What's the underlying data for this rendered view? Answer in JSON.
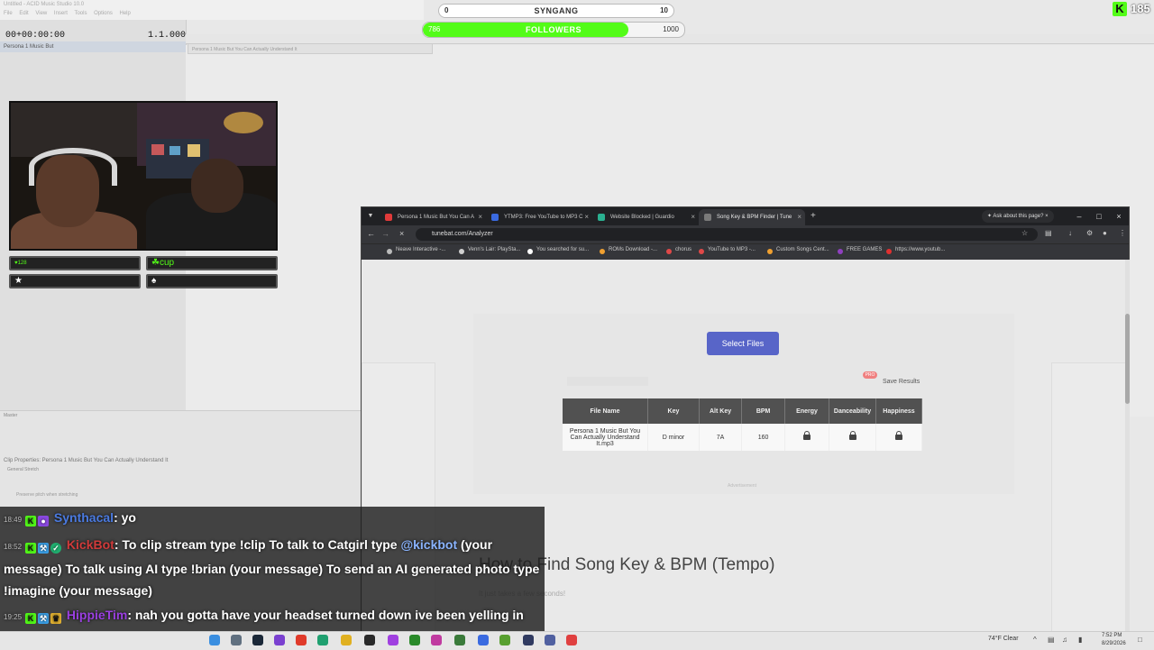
{
  "daw": {
    "title": "Untitled - ACID Music Studio 10.0",
    "menu": "File Edit View Insert Tools Options Help",
    "time": "00+00:00:00",
    "beat": "1.1.000",
    "track_name": "Persona 1 Music But",
    "clip_name": "Persona 1 Music But You Can Actually Understand It",
    "master": "Master",
    "clip_properties": "Clip Properties: Persona 1 Music But You Can Actually Understand It",
    "tabs": "General   Stretch",
    "preserve": "Preserve pitch when stretching"
  },
  "overlay": {
    "syngang": {
      "left": "0",
      "label": "SYNGANG",
      "right": "10",
      "progress": 0.0
    },
    "followers": {
      "left": "786",
      "label": "FOLLOWERS",
      "right": "1000",
      "progress": 0.786
    },
    "kick_count": "185",
    "kick_letter": "K"
  },
  "webcam_badges": [
    "♥128",
    "☘cup",
    "★",
    "♠"
  ],
  "browser": {
    "tabs": [
      {
        "label": "Persona 1 Music But You Can A",
        "color": "#e03a3a"
      },
      {
        "label": "YTMP3: Free YouTube to MP3 C",
        "color": "#3a6ae0"
      },
      {
        "label": "Website Blocked | Guardio",
        "color": "#2ab090"
      },
      {
        "label": "Song Key & BPM Finder | Tune",
        "color": "#7a7a7a"
      }
    ],
    "ask_page": "Ask about this page?",
    "url": "tunebat.com/Analyzer",
    "bookmarks": [
      {
        "label": "Neave Interactive -...",
        "color": "#bbbbbb"
      },
      {
        "label": "Venn's Lair: PlaySta...",
        "color": "#d0d0d0"
      },
      {
        "label": "You searched for su...",
        "color": "#ffffff"
      },
      {
        "label": "ROMs Download -...",
        "color": "#f0a030"
      },
      {
        "label": "chorus",
        "color": "#e04848"
      },
      {
        "label": "YouTube to MP3 -...",
        "color": "#e04848"
      },
      {
        "label": "Custom Songs Cent...",
        "color": "#f0a030"
      },
      {
        "label": "FREE GAMES",
        "color": "#9040c0"
      },
      {
        "label": "https://www.youtub...",
        "color": "#e03030"
      }
    ]
  },
  "page": {
    "select_files": "Select Files",
    "pro": "PRO",
    "save_results": "Save Results",
    "table": {
      "headers": [
        "File Name",
        "Key",
        "Alt Key",
        "BPM",
        "Energy",
        "Danceability",
        "Happiness"
      ],
      "rows": [
        {
          "file": "Persona 1 Music But You Can Actually Understand It.mp3",
          "key": "D minor",
          "alt_key": "7A",
          "bpm": "160"
        }
      ]
    },
    "advertisement": "Advertisement",
    "how_title": "How to Find Song Key & BPM (Tempo)",
    "how_sub": "It just takes a few seconds!"
  },
  "chat": [
    {
      "time": "18:49",
      "user": "Synthacal",
      "message": ": yo"
    },
    {
      "time": "18:52",
      "user": "KickBot",
      "message_pre": ": To clip stream type !clip To talk to Catgirl type ",
      "mention": "@kickbot",
      "message_post": " (your message) To talk using AI type !brian (your message) To send an AI generated photo type !imagine (your message)"
    },
    {
      "time": "19:25",
      "user": "HippieTim",
      "message": ": nah you gotta have your headset turned down ive been yelling in here for almost a hour"
    }
  ],
  "taskbar": {
    "weather": "74°F  Clear",
    "time": "7:52 PM",
    "date": "8/29/2026"
  }
}
